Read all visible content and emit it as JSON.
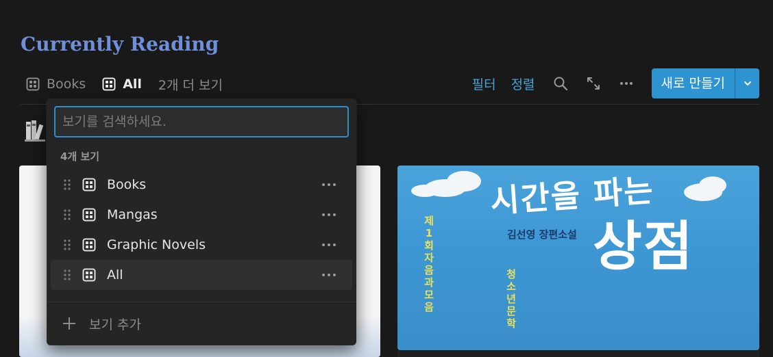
{
  "page": {
    "title": "Currently Reading"
  },
  "views": {
    "tabs": [
      {
        "label": "Books",
        "active": false
      },
      {
        "label": "All",
        "active": true
      }
    ],
    "more_label": "2개 더 보기"
  },
  "toolbar": {
    "filter_label": "필터",
    "sort_label": "정렬",
    "new_label": "새로 만들기",
    "icons": [
      "search-icon",
      "expand-icon",
      "more-icon",
      "chevron-down-icon"
    ],
    "accent_color": "#2e93d1"
  },
  "view_menu": {
    "search_placeholder": "보기를 검색하세요.",
    "search_value": "",
    "count_label": "4개 보기",
    "items": [
      {
        "label": "Books"
      },
      {
        "label": "Mangas"
      },
      {
        "label": "Graphic Novels"
      },
      {
        "label": "All"
      }
    ],
    "add_label": "보기 추가"
  },
  "cards": {
    "right": {
      "cover_title_top": "시간을 파는",
      "cover_title_main": "상점",
      "cover_author": "김선영 장편소설",
      "cover_award_vertical": "제1회자음과모음",
      "cover_award_vertical_2": "청소년문학"
    }
  }
}
